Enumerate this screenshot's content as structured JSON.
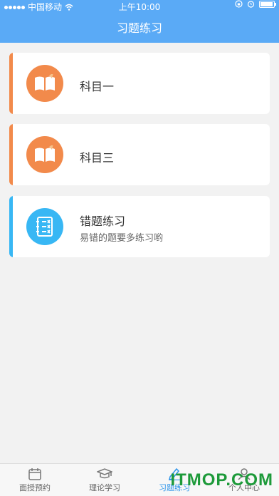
{
  "status_bar": {
    "carrier": "中国移动",
    "time": "上午10:00",
    "battery_level": 0.95
  },
  "header": {
    "title": "习题练习"
  },
  "cards": [
    {
      "label": "科目一",
      "icon": "book-icon",
      "accent": "#f28a4b"
    },
    {
      "label": "科目三",
      "icon": "book-icon",
      "accent": "#f28a4b"
    },
    {
      "label": "错题练习",
      "subtitle": "易错的题要多练习哟",
      "icon": "checklist-icon",
      "accent": "#38b7f4"
    }
  ],
  "tabbar": {
    "items": [
      {
        "label": "面授预约",
        "icon": "calendar-icon"
      },
      {
        "label": "理论学习",
        "icon": "graduation-cap-icon"
      },
      {
        "label": "习题练习",
        "icon": "pencil-icon",
        "active": true
      },
      {
        "label": "个人中心",
        "icon": "person-icon"
      }
    ]
  },
  "watermark": "ITMOP.COM",
  "colors": {
    "header": "#5aaaf6",
    "active_tab": "#2f95ea"
  }
}
